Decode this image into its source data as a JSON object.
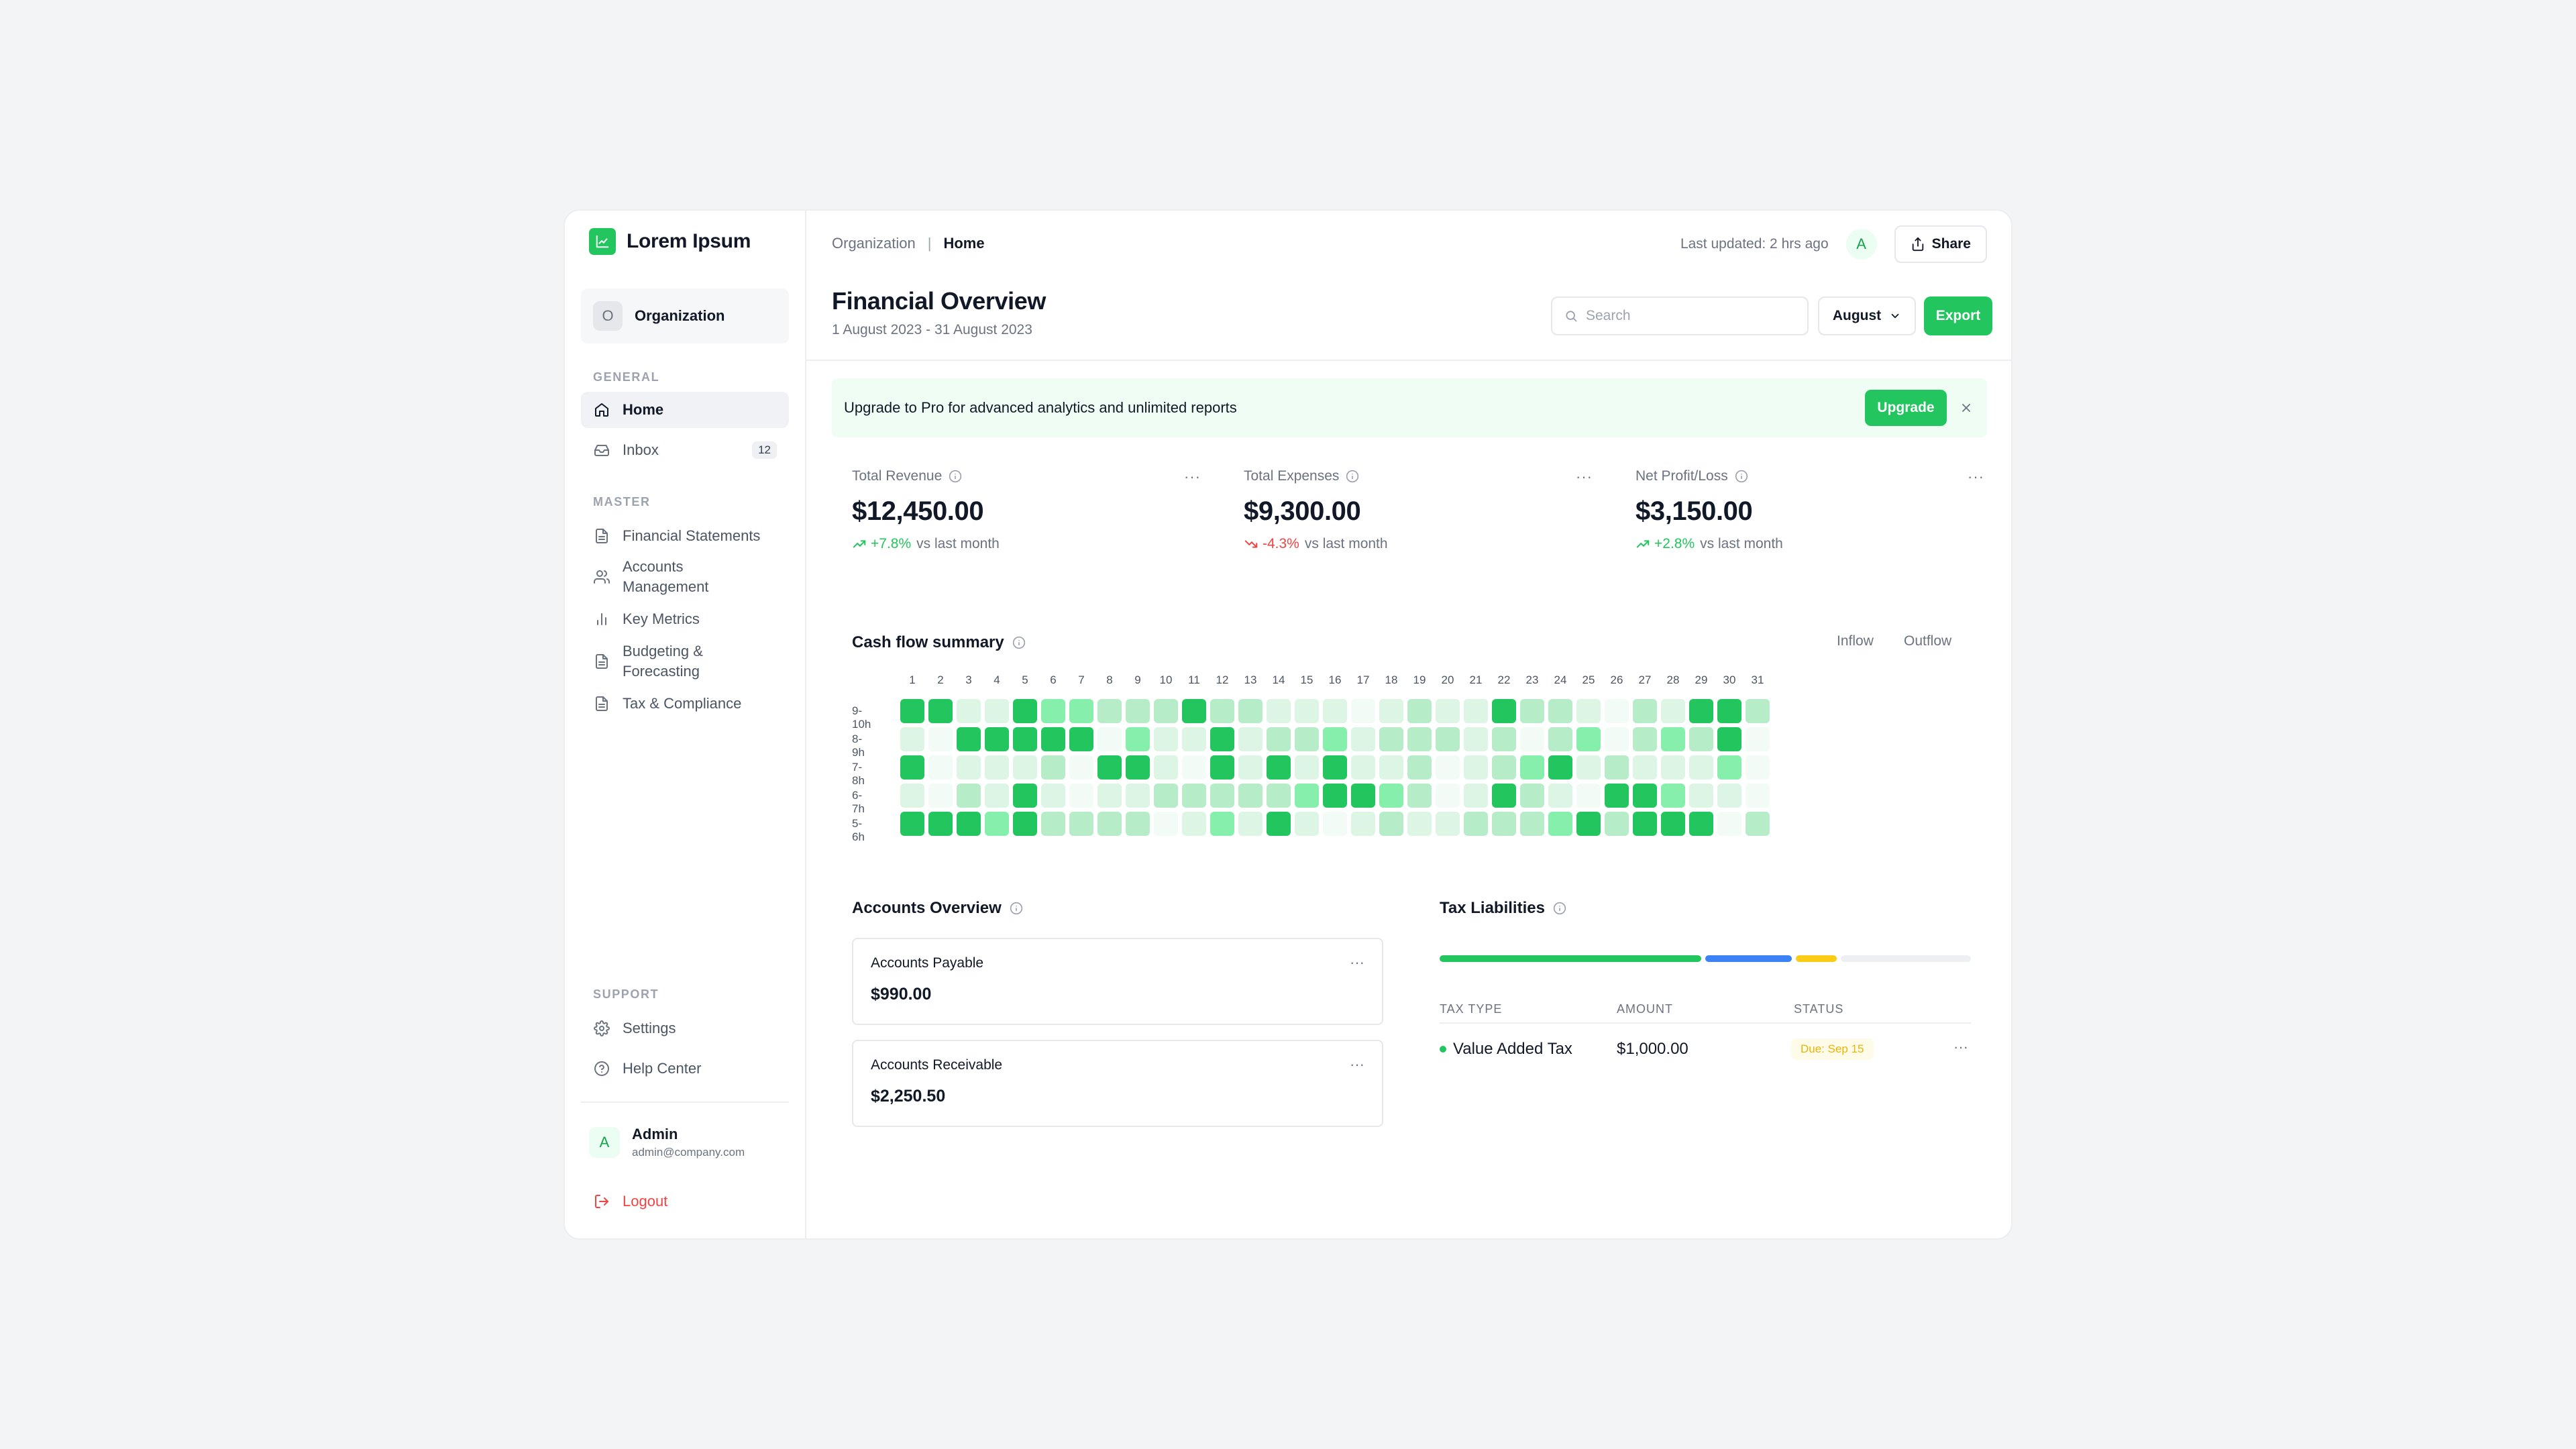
{
  "brand": {
    "name": "Lorem Ipsum"
  },
  "org": {
    "avatar": "O",
    "name": "Organization"
  },
  "sidebar": {
    "general_label": "GENERAL",
    "master_label": "MASTER",
    "support_label": "SUPPORT",
    "general": [
      {
        "label": "Home",
        "icon": "home-icon"
      },
      {
        "label": "Inbox",
        "icon": "inbox-icon",
        "badge": "12"
      }
    ],
    "master": [
      {
        "label": "Financial Statements",
        "icon": "document-icon"
      },
      {
        "label": "Accounts Management",
        "icon": "users-icon"
      },
      {
        "label": "Key Metrics",
        "icon": "bar-chart-icon"
      },
      {
        "label": "Budgeting & Forecasting",
        "icon": "document-icon"
      },
      {
        "label": "Tax & Compliance",
        "icon": "document-icon"
      }
    ],
    "support": [
      {
        "label": "Settings",
        "icon": "gear-icon"
      },
      {
        "label": "Help Center",
        "icon": "help-icon"
      }
    ]
  },
  "user": {
    "avatar": "A",
    "name": "Admin",
    "email": "admin@company.com"
  },
  "logout_label": "Logout",
  "breadcrumb": {
    "parent": "Organization",
    "separator": "|",
    "current": "Home"
  },
  "header": {
    "last_updated": "Last updated: 2 hrs ago",
    "avatar": "A",
    "share_label": "Share",
    "title": "Financial Overview",
    "subtitle": "1 August 2023 - 31 August 2023",
    "search_placeholder": "Search",
    "month": "August",
    "export_label": "Export"
  },
  "banner": {
    "text": "Upgrade to Pro for advanced analytics and unlimited reports",
    "button": "Upgrade"
  },
  "stats": [
    {
      "title": "Total Revenue",
      "value": "$12,450.00",
      "change": "+7.8%",
      "direction": "up",
      "suffix": "vs last month"
    },
    {
      "title": "Total Expenses",
      "value": "$9,300.00",
      "change": "-4.3%",
      "direction": "down",
      "suffix": "vs last month"
    },
    {
      "title": "Net Profit/Loss",
      "value": "$3,150.00",
      "change": "+2.8%",
      "direction": "up",
      "suffix": "vs last month"
    }
  ],
  "cashflow": {
    "title": "Cash flow summary",
    "tabs": [
      "Inflow",
      "Outflow"
    ],
    "days": [
      "1",
      "2",
      "3",
      "4",
      "5",
      "6",
      "7",
      "8",
      "9",
      "10",
      "11",
      "12",
      "13",
      "14",
      "15",
      "16",
      "17",
      "18",
      "19",
      "20",
      "21",
      "22",
      "23",
      "24",
      "25",
      "26",
      "27",
      "28",
      "29",
      "30",
      "31"
    ],
    "rows": [
      "9-10h",
      "8-9h",
      "7-8h",
      "6-7h",
      "5-6h"
    ],
    "levels": [
      [
        4,
        4,
        1,
        1,
        4,
        3,
        3,
        2,
        2,
        2,
        4,
        2,
        2,
        1,
        1,
        1,
        0,
        1,
        2,
        1,
        1,
        4,
        2,
        2,
        1,
        0,
        2,
        1,
        4,
        4,
        2
      ],
      [
        1,
        0,
        4,
        4,
        4,
        4,
        4,
        0,
        3,
        1,
        1,
        4,
        1,
        2,
        2,
        3,
        1,
        2,
        2,
        2,
        1,
        2,
        0,
        2,
        3,
        0,
        2,
        3,
        2,
        4,
        0
      ],
      [
        4,
        0,
        1,
        1,
        1,
        2,
        0,
        4,
        4,
        1,
        0,
        4,
        1,
        4,
        1,
        4,
        1,
        1,
        2,
        0,
        1,
        2,
        3,
        4,
        1,
        2,
        1,
        1,
        1,
        3,
        0
      ],
      [
        1,
        0,
        2,
        1,
        4,
        1,
        0,
        1,
        1,
        2,
        2,
        2,
        2,
        2,
        3,
        4,
        4,
        3,
        2,
        0,
        1,
        4,
        2,
        1,
        0,
        4,
        4,
        3,
        1,
        1,
        0
      ],
      [
        4,
        4,
        4,
        3,
        4,
        2,
        2,
        2,
        2,
        0,
        1,
        3,
        1,
        4,
        1,
        0,
        1,
        2,
        1,
        1,
        2,
        2,
        2,
        3,
        4,
        2,
        4,
        4,
        4,
        0,
        2
      ]
    ],
    "colors": [
      "#f3fbf6",
      "#dcf5e5",
      "#b6ecc8",
      "#86efac",
      "#22c55e"
    ]
  },
  "accounts": {
    "title": "Accounts Overview",
    "items": [
      {
        "label": "Accounts Payable",
        "value": "$990.00"
      },
      {
        "label": "Accounts Receivable",
        "value": "$2,250.50"
      }
    ]
  },
  "tax": {
    "title": "Tax Liabilities",
    "bar_segments": [
      {
        "fraction": 0.5,
        "color": "#22c55e"
      },
      {
        "fraction": 0.17,
        "color": "#3b82f6"
      },
      {
        "fraction": 0.085,
        "color": "#facc15"
      },
      {
        "fraction": 0.245,
        "color": "#eeeff2"
      }
    ],
    "columns": [
      "TAX TYPE",
      "AMOUNT",
      "STATUS"
    ],
    "rows": [
      {
        "type": "Value Added Tax",
        "amount": "$1,000.00",
        "status": "Due: Sep 15"
      }
    ]
  },
  "colors": {
    "accent": "#22c55e",
    "danger": "#ef4444",
    "warning": "#eab308"
  }
}
